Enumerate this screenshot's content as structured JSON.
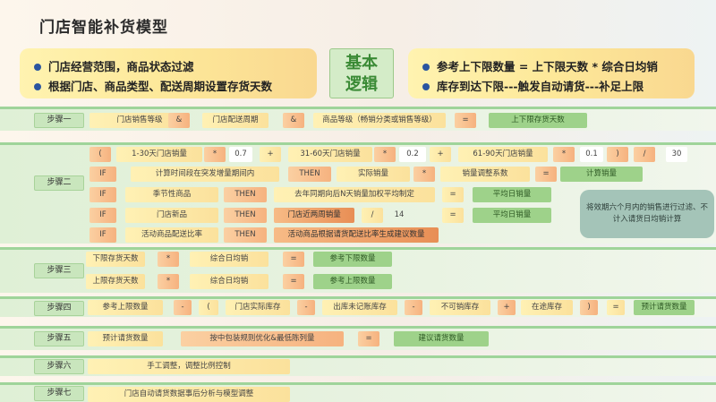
{
  "title": "门店智能补货模型",
  "left_panel": [
    "门店经营范围，商品状态过滤",
    "根据门店、商品类型、配送周期设置存货天数"
  ],
  "logic": [
    "基本",
    "逻辑"
  ],
  "right_panel": [
    "参考上下限数量 = 上下限天数 * 综合日均销",
    "库存到达下限---触发自动请货---补足上限"
  ],
  "steps": {
    "s1": "步骤一",
    "s2": "步骤二",
    "s3": "步骤三",
    "s4": "步骤四",
    "s5": "步骤五",
    "s6": "步骤六",
    "s7": "步骤七"
  },
  "row1": [
    "门店销售等级",
    "&",
    "门店配送周期",
    "&",
    "商品等级（畅销分类或销售等级）",
    "=",
    "上下限存货天数"
  ],
  "row2a": [
    "(",
    "1-30天门店销量",
    "*",
    "0.7",
    "+",
    "31-60天门店销量",
    "*",
    "0.2",
    "+",
    "61-90天门店销量",
    "*",
    "0.1",
    ")",
    "/",
    "30"
  ],
  "row2b": [
    "IF",
    "计算时间段在突发增量期间内",
    "THEN",
    "实际销量",
    "*",
    "销量调整系数",
    "=",
    "计算销量"
  ],
  "row2c": [
    "IF",
    "季节性商品",
    "THEN",
    "去年同期向后N天销量加权平均制定",
    "=",
    "平均日销量"
  ],
  "row2d": [
    "IF",
    "门店新品",
    "THEN",
    "门店近两周销量",
    "/",
    "14",
    "=",
    "平均日销量"
  ],
  "row2e": [
    "IF",
    "活动商品配送比率",
    "THEN",
    "活动商品根据请货配送比率生成建议数量"
  ],
  "note": "将效期六个月内的销售进行过滤、不计入请货日均销计算",
  "row3a": [
    "下限存货天数",
    "*",
    "综合日均销",
    "=",
    "参考下限数量"
  ],
  "row3b": [
    "上限存货天数",
    "*",
    "综合日均销",
    "=",
    "参考上限数量"
  ],
  "row4": [
    "参考上限数量",
    "-",
    "(",
    "门店实际库存",
    "-",
    "出库未记账库存",
    "-",
    "不可销库存",
    "+",
    "在途库存",
    ")",
    "=",
    "预计请货数量"
  ],
  "row5": [
    "预计请货数量",
    "按中包装规则优化&最低陈列量",
    "=",
    "建议请货数量"
  ],
  "row6": [
    "手工调整，调整比例控制"
  ],
  "row7": [
    "门店自动请货数据事后分析与模型调整"
  ]
}
